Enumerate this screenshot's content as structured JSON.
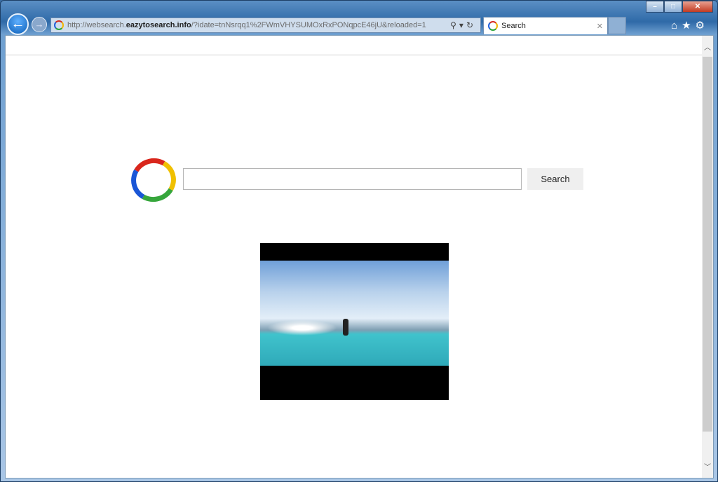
{
  "browser": {
    "url_prefix": "http://websearch.",
    "url_domain": "eazytosearch.info",
    "url_suffix": "/?idate=tnNsrqq1%2FWmVHYSUMOxRxPONqpcE46jU&reloaded=1",
    "tab_title": "Search",
    "icons": [
      "back-arrow-icon",
      "forward-arrow-icon",
      "search-icon",
      "refresh-icon",
      "close-icon",
      "home-icon",
      "star-icon",
      "gear-icon"
    ]
  },
  "page": {
    "search_placeholder": "",
    "search_button": "Search",
    "logo_colors": [
      "#d9261c",
      "#f0c000",
      "#36a63c",
      "#1a56d6"
    ]
  }
}
